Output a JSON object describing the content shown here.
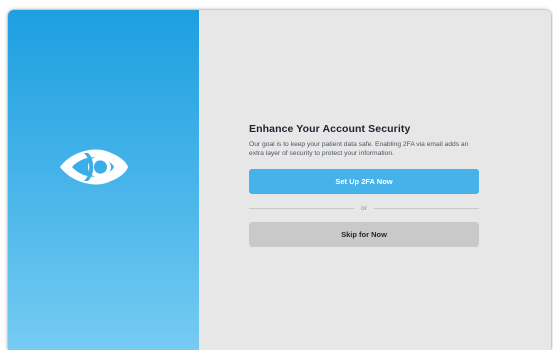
{
  "brand": {
    "logo_icon": "eye-logo-icon",
    "gradient_top": "#1d9fe0",
    "gradient_bottom": "#76cbf2"
  },
  "dialog": {
    "title": "Enhance Your Account Security",
    "description": "Our goal is to keep your patient data safe. Enabling 2FA via email adds an extra layer of security to protect your information.",
    "primary_button_label": "Set Up 2FA Now",
    "divider_text": "or",
    "secondary_button_label": "Skip for Now"
  },
  "colors": {
    "accent": "#45b3ea",
    "secondary_button": "#c9c9c9",
    "panel_background": "#e7e7e7"
  }
}
